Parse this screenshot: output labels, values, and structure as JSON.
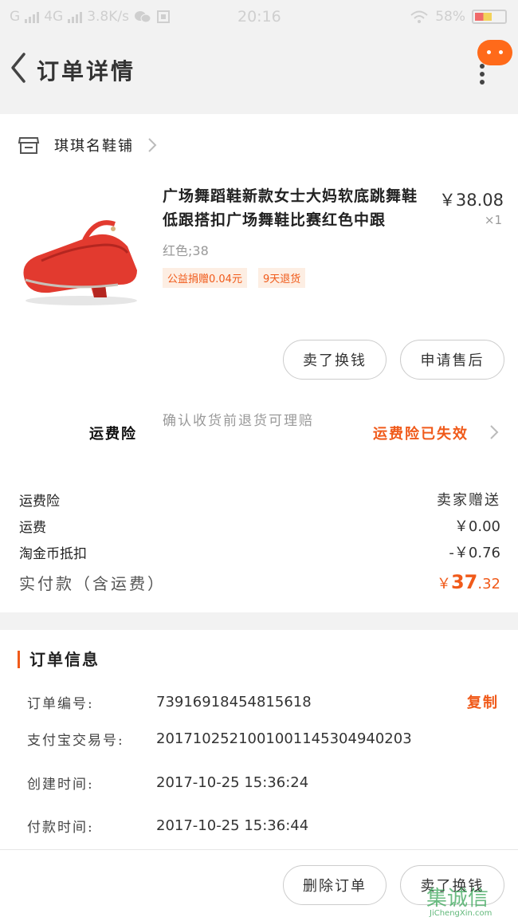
{
  "status_bar": {
    "signal1": "G",
    "signal2": "4G",
    "speed": "3.8K/s",
    "time": "20:16",
    "battery": "58%",
    "battery_level": 0.58
  },
  "nav": {
    "title": "订单详情"
  },
  "shop": {
    "name": "琪琪名鞋铺"
  },
  "product": {
    "title": "广场舞蹈鞋新款女士大妈软底跳舞鞋低跟搭扣广场舞鞋比赛红色中跟",
    "price": "￥38.08",
    "qty": "×1",
    "spec": "红色;38",
    "tags": [
      "公益捐赠0.04元",
      "9天退货"
    ]
  },
  "actions": {
    "sell_label": "卖了换钱",
    "after_sale_label": "申请售后"
  },
  "insurance": {
    "label": "运费险",
    "desc": "确认收货前退货可理赔",
    "status": "运费险已失效"
  },
  "fees": [
    {
      "label": "运费险",
      "value": "卖家赠送"
    },
    {
      "label": "运费",
      "value": "￥0.00"
    },
    {
      "label": "淘金币抵扣",
      "value": "-￥0.76"
    }
  ],
  "paid": {
    "label": "实付款（含运费）",
    "currency": "￥",
    "integer": "37",
    "decimal": ".32"
  },
  "order_info": {
    "title": "订单信息",
    "rows": [
      {
        "label": "订单编号:",
        "value": "73916918454815618",
        "action": "复制"
      },
      {
        "label": "支付宝交易号:",
        "value": "2017102521001001145304940203"
      },
      {
        "label": "创建时间:",
        "value": "2017-10-25 15:36:24"
      },
      {
        "label": "付款时间:",
        "value": "2017-10-25 15:36:44"
      }
    ]
  },
  "bottom": {
    "delete_label": "删除订单",
    "sell_label": "卖了换钱"
  },
  "watermark": {
    "mark": "集诚信",
    "url": "JiChengXin.com"
  },
  "colors": {
    "accent": "#f05a1a",
    "chat_badge": "#ff6a1a",
    "tag_bg": "#fdeee3"
  }
}
